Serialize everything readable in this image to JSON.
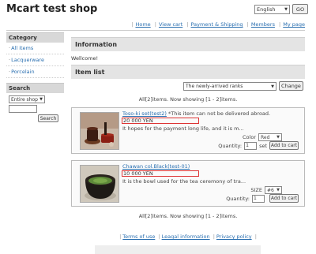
{
  "site": {
    "title": "Mcart test shop"
  },
  "header": {
    "language": "English",
    "go_label": "GO"
  },
  "nav": {
    "items": [
      "Home",
      "View cart",
      "Payment & Shipping",
      "Members",
      "My page"
    ]
  },
  "sidebar": {
    "category_title": "Category",
    "categories": [
      "All items",
      "Lacquerware",
      "Porcelain"
    ],
    "search_title": "Search",
    "search_scope": "Entire shop",
    "search_button": "Search"
  },
  "main": {
    "info_title": "Information",
    "welcome": "Wellcome!",
    "itemlist_title": "Item list",
    "sort_value": "The newly-arrived ranks",
    "change_label": "Change",
    "count_text": "All[2]items. Now showing [1 - 2]items."
  },
  "items": [
    {
      "name": "Toso-ki set(test2)",
      "note": " *This item can not be delivered abroad.",
      "price": "20 000 YEN",
      "desc": "It hopes for the payment long life, and it is m...",
      "option_label": "Color",
      "option_value": "Red",
      "qty_label": "Quantity:",
      "qty_value": "1",
      "unit": "set",
      "cart_label": "Add to cart"
    },
    {
      "name": "Chawan col.Black(test-01)",
      "note": "",
      "price": "10 000 YEN",
      "desc": "It is the bowl used for the tea ceremony of tra...",
      "option_label": "SIZE",
      "option_value": "#6",
      "qty_label": "Quantity:",
      "qty_value": "1",
      "unit": "",
      "cart_label": "Add to cart"
    }
  ],
  "footer": {
    "links": [
      "Terms of use",
      "Leagal information",
      "Privacy policy"
    ]
  },
  "colors": {
    "link": "#2a6fb0",
    "price_border": "#d33333",
    "header_bg": "#e4e4e4"
  }
}
